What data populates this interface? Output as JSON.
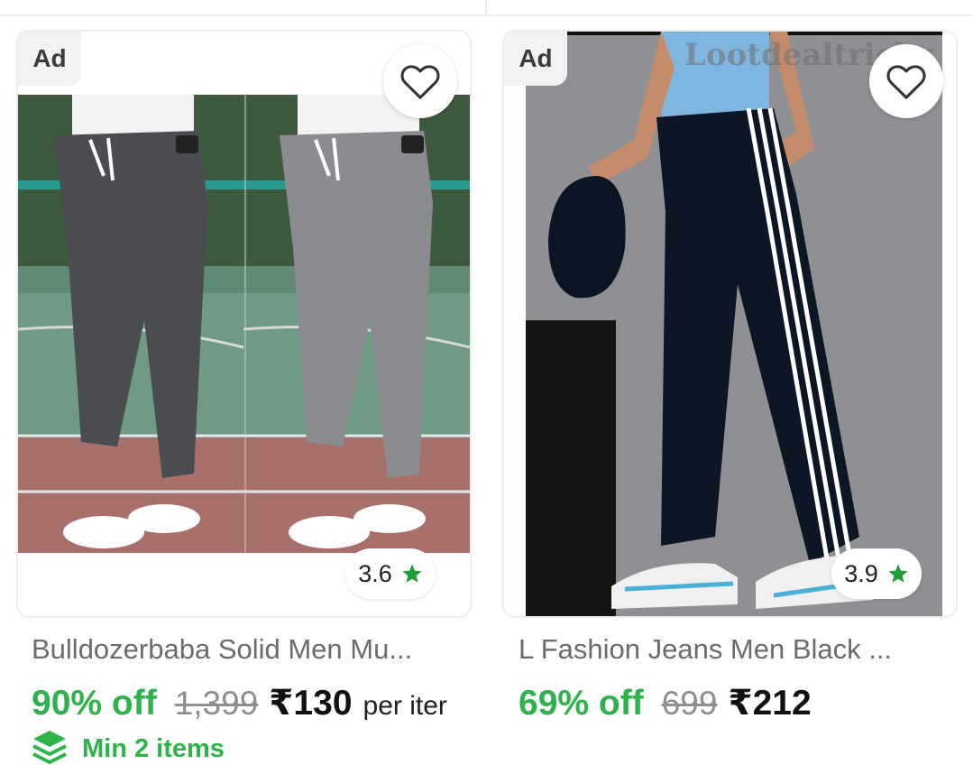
{
  "products": [
    {
      "ad_label": "Ad",
      "rating": "3.6",
      "title": "Bulldozerbaba Solid Men Mu...",
      "discount": "90% off",
      "mrp": "1,399",
      "price": "₹130",
      "unit": "per iter",
      "min_items": "Min 2 items",
      "colors": {
        "accent": "#2db34a",
        "star": "#1f9d3a"
      }
    },
    {
      "ad_label": "Ad",
      "rating": "3.9",
      "title": "L Fashion Jeans Men Black ...",
      "discount": "69% off",
      "mrp": "699",
      "price": "₹212",
      "watermark": "Lootdealtricky",
      "colors": {
        "accent": "#2db34a",
        "star": "#1f9d3a"
      }
    }
  ],
  "icons": [
    "heart-icon",
    "star-icon",
    "layers-icon"
  ]
}
